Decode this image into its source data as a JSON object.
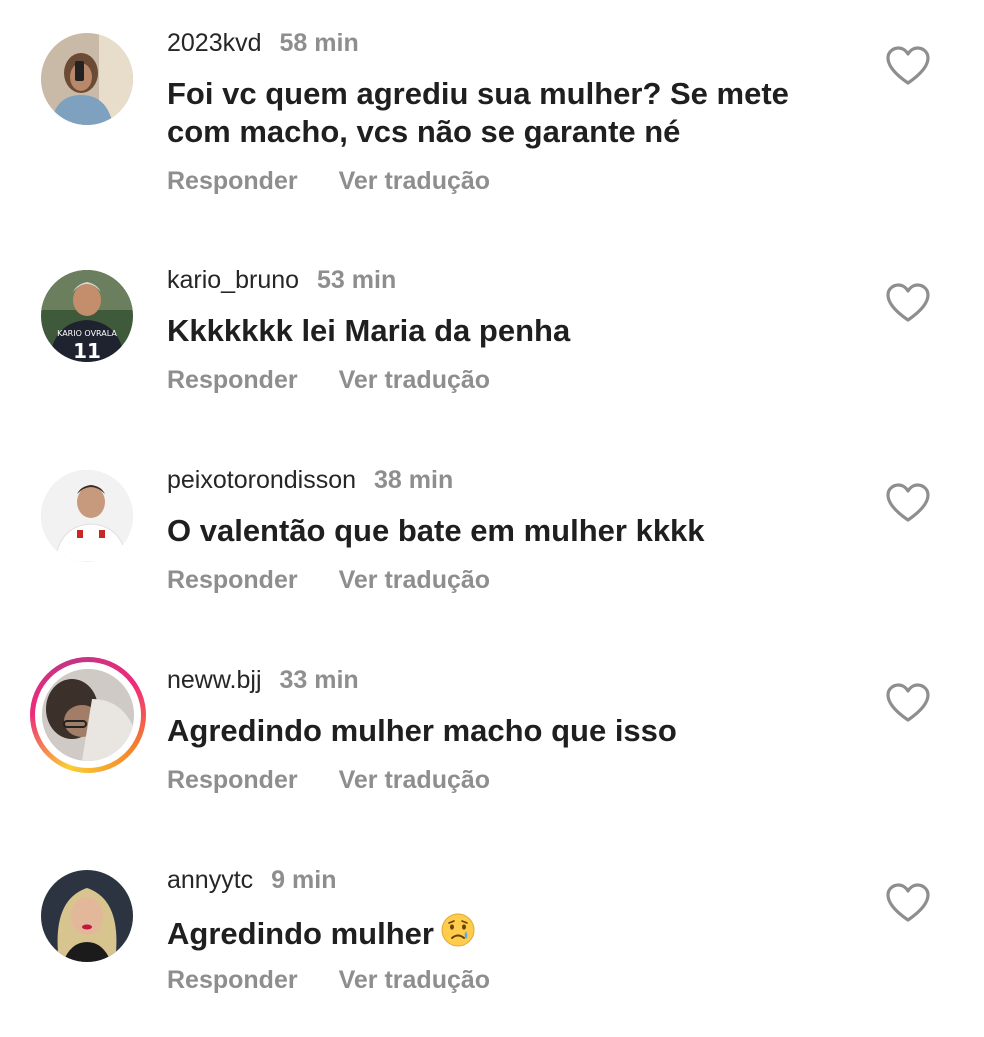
{
  "comments": [
    {
      "username": "2023kvd",
      "time": "58 min",
      "text": "Foi vc quem agrediu sua mulher? Se mete com macho, vcs não se garante né",
      "reply_label": "Responder",
      "translate_label": "Ver tradução",
      "has_story": false
    },
    {
      "username": "kario_bruno",
      "time": "53 min",
      "text": "Kkkkkkk lei Maria da penha",
      "reply_label": "Responder",
      "translate_label": "Ver tradução",
      "has_story": false
    },
    {
      "username": "peixotorondisson",
      "time": "38 min",
      "text": "O valentão que bate em mulher kkkk",
      "reply_label": "Responder",
      "translate_label": "Ver tradução",
      "has_story": false
    },
    {
      "username": "neww.bjj",
      "time": "33 min",
      "text": "Agredindo mulher macho que isso",
      "reply_label": "Responder",
      "translate_label": "Ver tradução",
      "has_story": true
    },
    {
      "username": "annyytc",
      "time": "9 min",
      "text": "Agredindo mulher",
      "emoji": "crying-face-emoji",
      "reply_label": "Responder",
      "translate_label": "Ver tradução",
      "has_story": false
    }
  ],
  "icons": {
    "like": "heart-outline-icon"
  },
  "colors": {
    "text": "#262626",
    "secondary": "#8e8e8e",
    "background": "#ffffff"
  }
}
